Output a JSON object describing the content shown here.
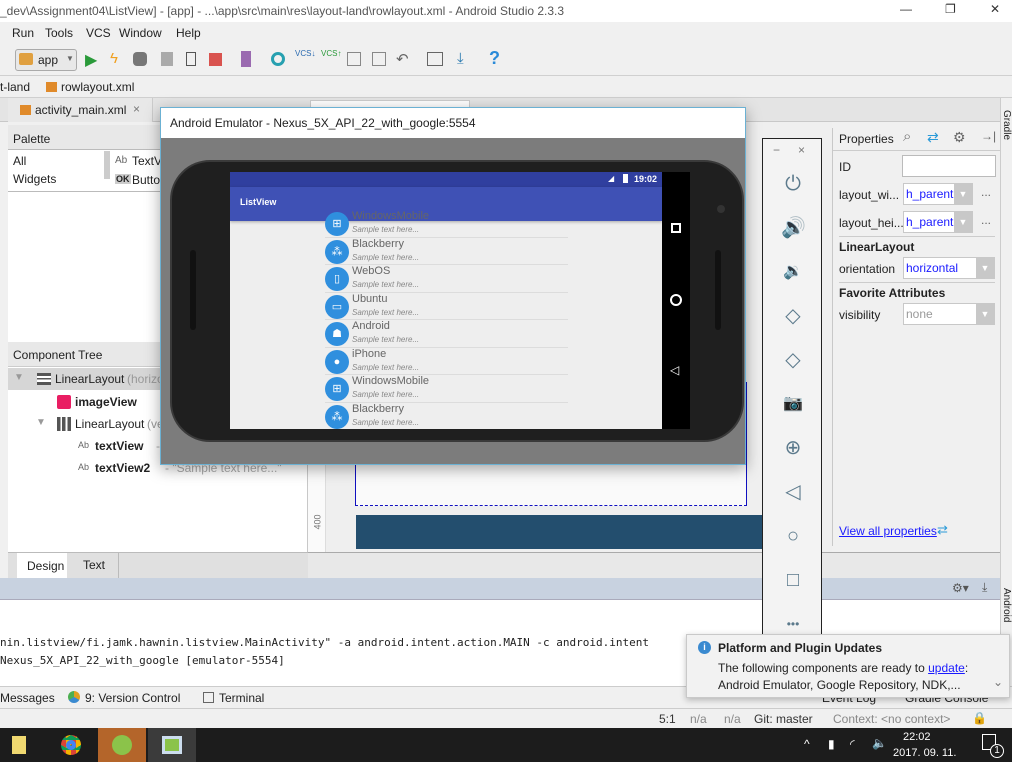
{
  "window": {
    "title": "_dev\\Assignment04\\ListView] - [app] - ...\\app\\src\\main\\res\\layout-land\\rowlayout.xml - Android Studio 2.3.3",
    "minimize": "—",
    "restore": "❐",
    "close": "✕"
  },
  "menu": [
    "Run",
    "Tools",
    "VCS",
    "Window",
    "Help"
  ],
  "toolbar": {
    "run_config": "app",
    "help": "?"
  },
  "breadcrumb": [
    "t-land",
    "rowlayout.xml"
  ],
  "editor_tabs": [
    {
      "label": "activity_main.xml",
      "close": "×"
    }
  ],
  "palette": {
    "title": "Palette",
    "categories": [
      "All",
      "Widgets"
    ],
    "items": [
      {
        "icon": "Ab",
        "label": "TextView"
      },
      {
        "icon": "OK",
        "label": "Button"
      }
    ]
  },
  "component_tree": {
    "title": "Component Tree",
    "nodes": [
      {
        "label": "LinearLayout",
        "hint": "(horizontal)"
      },
      {
        "label": "imageView",
        "hint": ""
      },
      {
        "label": "LinearLayout",
        "hint": "(vertical)"
      },
      {
        "label": "textView",
        "hint": "- \"..."
      },
      {
        "label": "textView2",
        "hint": "- \"Sample text here...\""
      }
    ]
  },
  "design_tabs": [
    "Design",
    "Text"
  ],
  "ruler_label": "400",
  "emulator": {
    "title": "Android Emulator - Nexus_5X_API_22_with_google:5554",
    "clock": "19:02",
    "app_title": "ListView",
    "rows": [
      {
        "title": "WindowsMobile",
        "sub": "Sample text here...",
        "icon": "windows"
      },
      {
        "title": "Blackberry",
        "sub": "Sample text here...",
        "icon": "blackberry"
      },
      {
        "title": "WebOS",
        "sub": "Sample text here...",
        "icon": "phone"
      },
      {
        "title": "Ubuntu",
        "sub": "Sample text here...",
        "icon": "tablet"
      },
      {
        "title": "Android",
        "sub": "Sample text here...",
        "icon": "android"
      },
      {
        "title": "iPhone",
        "sub": "Sample text here...",
        "icon": "apple"
      },
      {
        "title": "WindowsMobile",
        "sub": "Sample text here...",
        "icon": "windows"
      },
      {
        "title": "Blackberry",
        "sub": "Sample text here...",
        "icon": "blackberry"
      }
    ],
    "side_controls": [
      "power",
      "volume-up",
      "volume-down",
      "rotate-left",
      "rotate-right",
      "screenshot",
      "zoom",
      "back",
      "home",
      "overview",
      "more"
    ],
    "more": "•••",
    "minimize": "−",
    "close": "×"
  },
  "properties": {
    "title": "Properties",
    "id_label": "ID",
    "id_value": "",
    "layout_width_label": "layout_wi...",
    "layout_width": "h_parent",
    "layout_height_label": "layout_hei...",
    "layout_height": "h_parent",
    "section_linear": "LinearLayout",
    "orientation_label": "orientation",
    "orientation": "horizontal",
    "section_fav": "Favorite Attributes",
    "visibility_label": "visibility",
    "visibility": "none",
    "view_all": "View all properties",
    "more": "..."
  },
  "right_strip": {
    "gradle": "Gradle",
    "android": "Android"
  },
  "console": {
    "lines": [
      "nin.listview/fi.jamk.hawnin.listview.MainActivity\" -a android.intent.action.MAIN -c android.intent",
      "Nexus_5X_API_22_with_google [emulator-5554]"
    ]
  },
  "tool_tabs": [
    "Messages",
    "9: Version Control",
    "Terminal",
    "Event Log",
    "Gradle Console"
  ],
  "status": {
    "position": "5:1",
    "col1": "n/a",
    "col2": "n/a",
    "git": "Git: master",
    "context": "Context: <no context>"
  },
  "notification": {
    "title": "Platform and Plugin Updates",
    "text": "The following components are ready to ",
    "link": "update",
    "after": ":",
    "components": "Android Emulator, Google Repository, NDK,..."
  },
  "taskbar": {
    "time": "22:02",
    "date": "2017. 09. 11.",
    "notif_count": "1"
  },
  "colors": {
    "app_bar": "#3f51b5",
    "status_bar": "#303f9f",
    "list_icon": "#2f8fde",
    "link": "#1a1aff"
  }
}
